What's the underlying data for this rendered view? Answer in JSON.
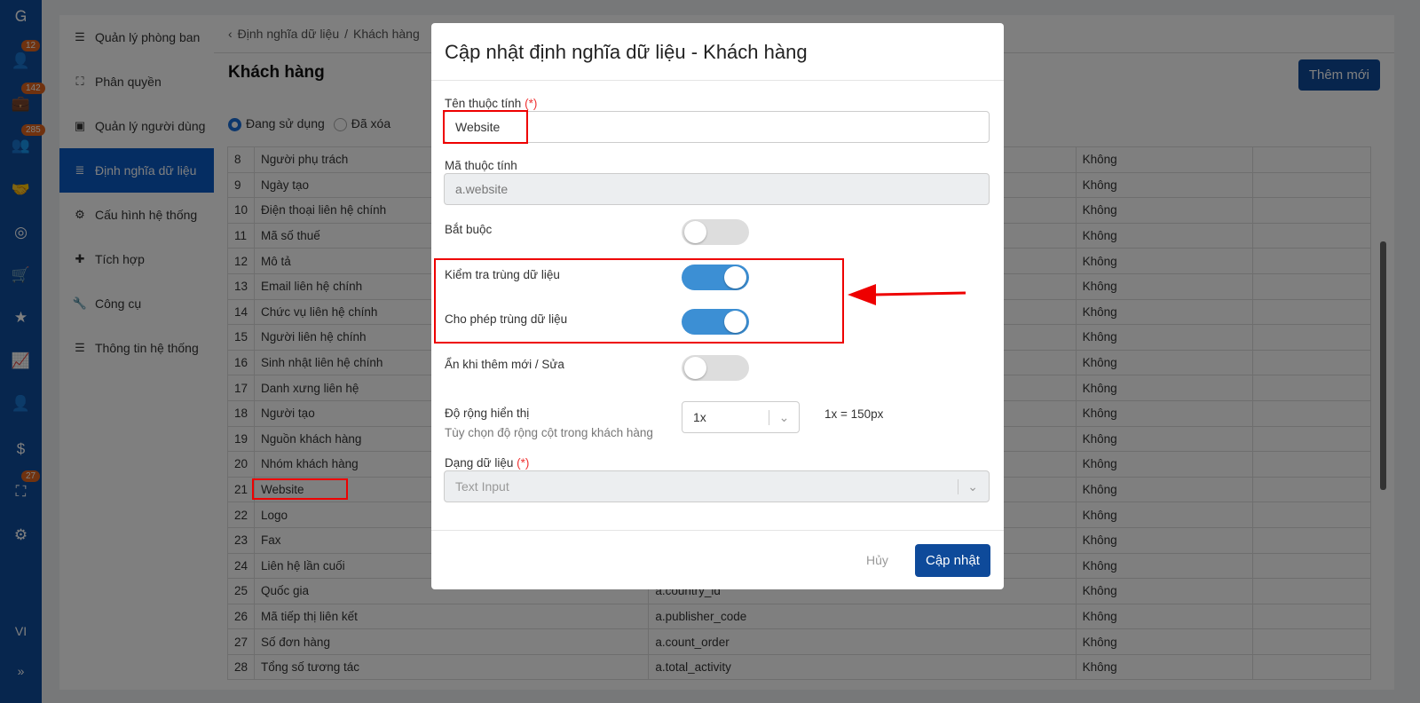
{
  "rail": {
    "items": [
      {
        "icon": "logo-icon"
      },
      {
        "icon": "user-icon",
        "badge": "12"
      },
      {
        "icon": "briefcase-icon",
        "badge": "142"
      },
      {
        "icon": "users-icon",
        "badge": "285"
      },
      {
        "icon": "handshake-icon"
      },
      {
        "icon": "target-icon"
      },
      {
        "icon": "cart-icon"
      },
      {
        "icon": "star-icon"
      },
      {
        "icon": "chart-icon"
      },
      {
        "icon": "person-icon"
      },
      {
        "icon": "dollar-icon"
      },
      {
        "icon": "org-icon",
        "badge": "27"
      },
      {
        "icon": "gear-icon"
      }
    ],
    "lang": "VI",
    "expand": "»"
  },
  "menu": {
    "items": [
      {
        "label": "Quản lý phòng ban",
        "icon": "sliders-icon"
      },
      {
        "label": "Phân quyền",
        "icon": "hierarchy-icon"
      },
      {
        "label": "Quản lý người dùng",
        "icon": "contact-book-icon"
      },
      {
        "label": "Định nghĩa dữ liệu",
        "icon": "list-icon",
        "active": true
      },
      {
        "label": "Cấu hình hệ thống",
        "icon": "gears-icon"
      },
      {
        "label": "Tích hợp",
        "icon": "puzzle-icon"
      },
      {
        "label": "Công cụ",
        "icon": "wrench-icon"
      },
      {
        "label": "Thông tin hệ thống",
        "icon": "server-icon"
      }
    ]
  },
  "breadcrumb": {
    "parent": "Định nghĩa dữ liệu",
    "sep": "/",
    "current": "Khách hàng"
  },
  "page": {
    "title": "Khách hàng",
    "add_button": "Thêm mới",
    "radio_active": "Đang sử dụng",
    "radio_deleted": "Đã xóa"
  },
  "table": {
    "rows": [
      [
        "8",
        "Người phụ trách",
        "",
        "Không"
      ],
      [
        "9",
        "Ngày tạo",
        "",
        "Không"
      ],
      [
        "10",
        "Điện thoại liên hệ chính",
        "",
        "Không"
      ],
      [
        "11",
        "Mã số thuế",
        "",
        "Không"
      ],
      [
        "12",
        "Mô tả",
        "",
        "Không"
      ],
      [
        "13",
        "Email liên hệ chính",
        "",
        "Không"
      ],
      [
        "14",
        "Chức vụ liên hệ chính",
        "",
        "Không"
      ],
      [
        "15",
        "Người liên hệ chính",
        "",
        "Không"
      ],
      [
        "16",
        "Sinh nhật liên hệ chính",
        "",
        "Không"
      ],
      [
        "17",
        "Danh xưng liên hệ",
        "",
        "Không"
      ],
      [
        "18",
        "Người tạo",
        "",
        "Không"
      ],
      [
        "19",
        "Nguồn khách hàng",
        "",
        "Không"
      ],
      [
        "20",
        "Nhóm khách hàng",
        "",
        "Không"
      ],
      [
        "21",
        "Website",
        "",
        "Không"
      ],
      [
        "22",
        "Logo",
        "",
        "Không"
      ],
      [
        "23",
        "Fax",
        "",
        "Không"
      ],
      [
        "24",
        "Liên hệ lần cuối",
        "",
        "Không"
      ],
      [
        "25",
        "Quốc gia",
        "a.country_id",
        "Không"
      ],
      [
        "26",
        "Mã tiếp thị liên kết",
        "a.publisher_code",
        "Không"
      ],
      [
        "27",
        "Số đơn hàng",
        "a.count_order",
        "Không"
      ],
      [
        "28",
        "Tổng số tương tác",
        "a.total_activity",
        "Không"
      ]
    ]
  },
  "modal": {
    "title": "Cập nhật định nghĩa dữ liệu - Khách hàng",
    "name_label": "Tên thuộc tính",
    "required_mark": "(*)",
    "name_value": "Website",
    "code_label": "Mã thuộc tính",
    "code_value": "a.website",
    "required_label": "Bắt buộc",
    "required_on": false,
    "check_dup_label": "Kiểm tra trùng dữ liệu",
    "check_dup_on": true,
    "allow_dup_label": "Cho phép trùng dữ liệu",
    "allow_dup_on": true,
    "hide_label": "Ẩn khi thêm mới / Sửa",
    "hide_on": false,
    "width_label": "Độ rộng hiển thị",
    "width_help": "Tùy chọn độ rộng cột trong khách hàng",
    "width_value": "1x",
    "width_note": "1x = 150px",
    "type_label": "Dạng dữ liệu",
    "type_value": "Text Input",
    "cancel": "Hủy",
    "submit": "Cập nhật"
  },
  "colors": {
    "primary": "#0e4a9a",
    "toggle_on": "#3c8fd4",
    "highlight": "#e00000"
  }
}
